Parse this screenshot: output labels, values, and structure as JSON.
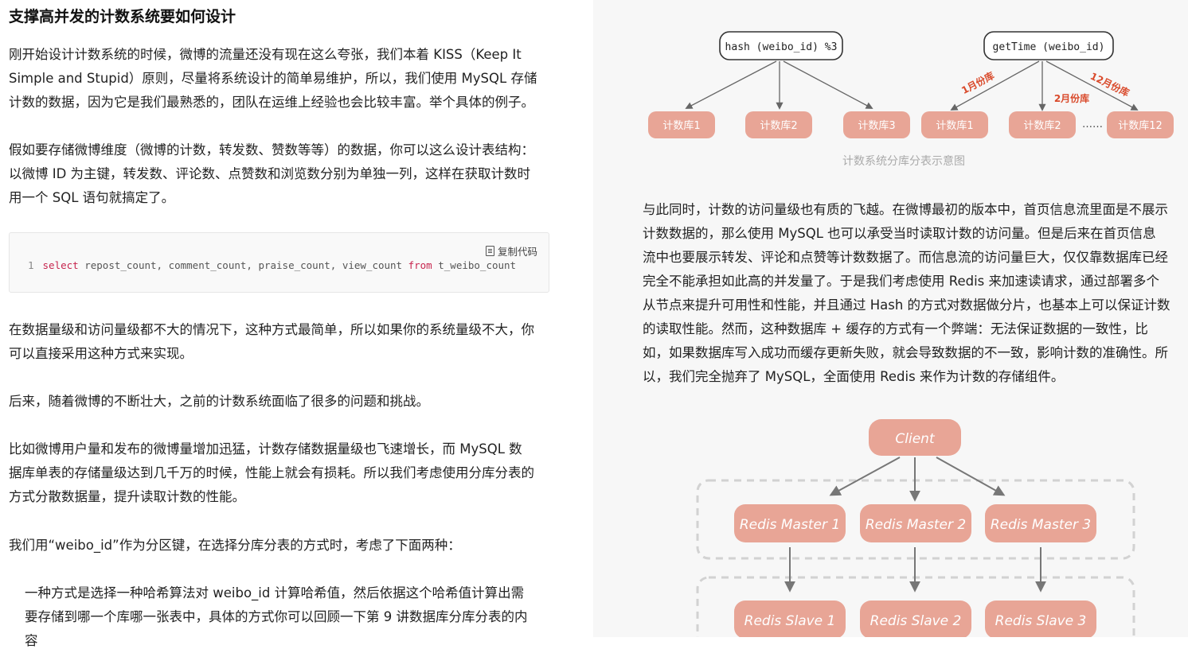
{
  "left": {
    "title": "支撑高并发的计数系统要如何设计",
    "p1": "刚开始设计计数系统的时候，微博的流量还没有现在这么夸张，我们本着 KISS（Keep It\nSimple and Stupid）原则，尽量将系统设计的简单易维护，所以，我们使用 MySQL 存储\n计数的数据，因为它是我们最熟悉的，团队在运维上经验也会比较丰富。举个具体的例子。",
    "p2": "假如要存储微博维度（微博的计数，转发数、赞数等等）的数据，你可以这么设计表结构：\n以微博 ID 为主键，转发数、评论数、点赞数和浏览数分别为单独一列，这样在获取计数时\n用一个 SQL 语句就搞定了。",
    "code": {
      "copy_label": "复制代码",
      "line_no": "1",
      "kw_select": "select",
      "cols": " repost_count, comment_count, praise_count, view_count ",
      "kw_from": "from",
      "table": " t_weibo_count"
    },
    "p3": "在数据量级和访问量级都不大的情况下，这种方式最简单，所以如果你的系统量级不大，你\n可以直接采用这种方式来实现。",
    "p4": "后来，随着微博的不断壮大，之前的计数系统面临了很多的问题和挑战。",
    "p5": "比如微博用户量和发布的微博量增加迅猛，计数存储数据量级也飞速增长，而 MySQL 数\n据库单表的存储量级达到几千万的时候，性能上就会有损耗。所以我们考虑使用分库分表的\n方式分散数据量，提升读取计数的性能。",
    "p6": "我们用“weibo_id”作为分区键，在选择分库分表的方式时，考虑了下面两种：",
    "li1": "一种方式是选择一种哈希算法对 weibo_id 计算哈希值，然后依据这个哈希值计算出需\n要存储到哪一个库哪一张表中，具体的方式你可以回顾一下第 9 讲数据库分库分表的内\n容"
  },
  "diagram1": {
    "hash_label": "hash (weibo_id) %3",
    "time_label": "getTime (weibo_id)",
    "hash_dbs": [
      "计数库1",
      "计数库2",
      "计数库3"
    ],
    "time_dbs": [
      "计数库1",
      "计数库2",
      "计数库12"
    ],
    "ellipsis": "……",
    "months": [
      "1月份库",
      "2月份库",
      "12月份库"
    ],
    "caption": "计数系统分库分表示意图"
  },
  "right": {
    "p1": "与此同时，计数的访问量级也有质的飞越。在微博最初的版本中，首页信息流里面是不展示\n计数数据的，那么使用 MySQL 也可以承受当时读取计数的访问量。但是后来在首页信息\n流中也要展示转发、评论和点赞等计数数据了。而信息流的访问量巨大，仅仅靠数据库已经\n完全不能承担如此高的并发量了。于是我们考虑使用 Redis 来加速读请求，通过部署多个\n从节点来提升可用性和性能，并且通过 Hash 的方式对数据做分片，也基本上可以保证计数\n的读取性能。然而，这种数据库 + 缓存的方式有一个弊端：无法保证数据的一致性，比\n如，如果数据库写入成功而缓存更新失败，就会导致数据的不一致，影响计数的准确性。所\n以，我们完全抛弃了 MySQL，全面使用 Redis 来作为计数的存储组件。"
  },
  "diagram2": {
    "client": "Client",
    "masters": [
      "Redis Master 1",
      "Redis Master 2",
      "Redis Master 3"
    ],
    "slaves": [
      "Redis Slave 1",
      "Redis Slave 2",
      "Redis Slave 3"
    ]
  },
  "colors": {
    "node_fill": "#e8a596",
    "arrow": "#777777",
    "month_text": "#d94a2b",
    "dashed_border": "#d2d2d2"
  }
}
